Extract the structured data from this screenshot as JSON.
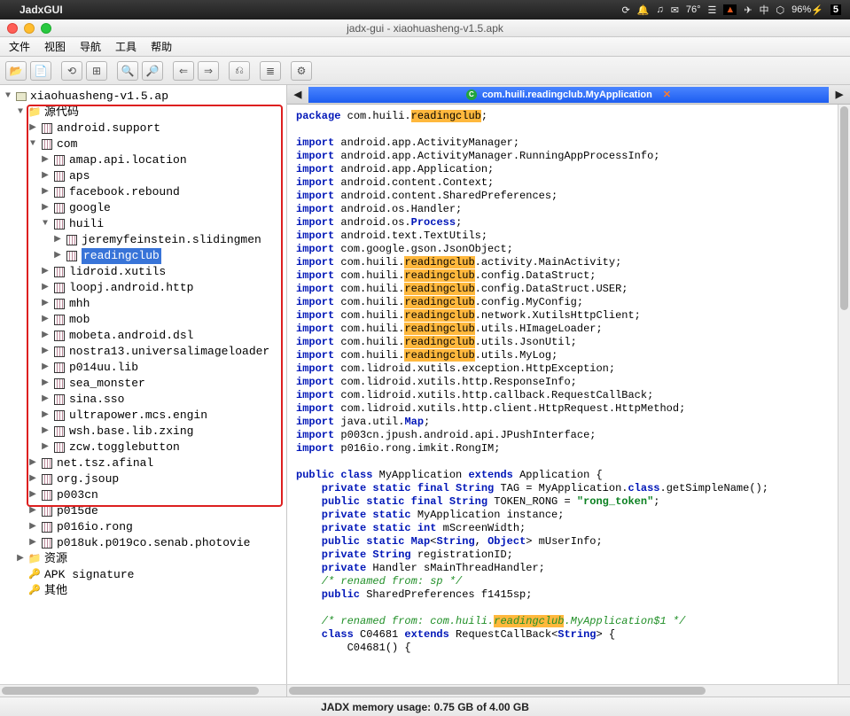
{
  "mac_menu": {
    "app": "JadxGUI",
    "temp": "76°",
    "battery": "96%",
    "ime": "中",
    "other": "5"
  },
  "window_title": "jadx-gui - xiaohuasheng-v1.5.apk",
  "app_menu": [
    "文件",
    "视图",
    "导航",
    "工具",
    "帮助"
  ],
  "tree": {
    "root": "xiaohuasheng-v1.5.ap",
    "binary": "010\n001",
    "sourcecode": "源代码",
    "com_children": [
      "amap.api.location",
      "aps",
      "facebook.rebound",
      "google"
    ],
    "huili": "huili",
    "huili_children": [
      "jeremyfeinstein.slidingmen",
      "readingclub"
    ],
    "com_after": [
      "lidroid.xutils",
      "loopj.android.http",
      "mhh",
      "mob",
      "mobeta.android.dsl",
      "nostra13.universalimageloader",
      "p014uu.lib",
      "sea_monster",
      "sina.sso",
      "ultrapower.mcs.engin",
      "wsh.base.lib.zxing",
      "zcw.togglebutton"
    ],
    "top_after": [
      "net.tsz.afinal",
      "org.jsoup",
      "p003cn",
      "p015de",
      "p016io.rong",
      "p018uk.p019co.senab.photovie"
    ],
    "resources": "资源",
    "apk_sig": "APK signature",
    "other": "其他",
    "android_support": "android.support",
    "com": "com"
  },
  "tab": {
    "label": "com.huili.readingclub.MyApplication"
  },
  "code": {
    "l1a": "package",
    "l1b": " com.huili.",
    "l1c": "readingclub",
    "l1d": ";",
    "imp": "import",
    "i1": " android.app.ActivityManager;",
    "i2": " android.app.ActivityManager.RunningAppProcessInfo;",
    "i3": " android.app.Application;",
    "i4": " android.content.Context;",
    "i5": " android.content.SharedPreferences;",
    "i6": " android.os.Handler;",
    "i7a": " android.os.",
    "i7b": "Process",
    "i7c": ";",
    "i8": " android.text.TextUtils;",
    "i9": " com.google.gson.JsonObject;",
    "h_pre": " com.huili.",
    "h_hl": "readingclub",
    "h1": ".activity.MainActivity;",
    "h2": ".config.DataStruct;",
    "h3": ".config.DataStruct.USER;",
    "h4": ".config.MyConfig;",
    "h5": ".network.XutilsHttpClient;",
    "h6": ".utils.HImageLoader;",
    "h7": ".utils.JsonUtil;",
    "h8": ".utils.MyLog;",
    "i10": " com.lidroid.xutils.exception.HttpException;",
    "i11": " com.lidroid.xutils.http.ResponseInfo;",
    "i12": " com.lidroid.xutils.http.callback.RequestCallBack;",
    "i13": " com.lidroid.xutils.http.client.HttpRequest.HttpMethod;",
    "i14": " java.util.",
    "i14b": "Map",
    "i14c": ";",
    "i15": " p003cn.jpush.android.api.JPushInterface;",
    "i16": " p016io.rong.imkit.RongIM;",
    "cls1": "public class",
    "cls2": " MyApplication ",
    "cls3": "extends",
    "cls4": " Application {",
    "f1a": "    private static final ",
    "f1s": "String",
    "f1b": " TAG = MyApplication.",
    "f1k": "class",
    "f1c": ".getSimpleName();",
    "f2a": "    public static final ",
    "f2b": " TOKEN_RONG = ",
    "f2str": "\"rong_token\"",
    "f2c": ";",
    "f3": "    private static",
    "f3b": " MyApplication instance;",
    "f4a": "    private static ",
    "f4int": "int",
    "f4b": " mScreenWidth;",
    "f5a": "    public static ",
    "f5m": "Map",
    "f5b": "<",
    "f5s": "String",
    "f5c": ", ",
    "f5o": "Object",
    "f5d": "> mUserInfo;",
    "f6a": "    private ",
    "f6b": " registrationID;",
    "f7": "    private",
    "f7b": " Handler sMainThreadHandler;",
    "c1": "    /* renamed from: sp */",
    "f8a": "    public",
    "f8b": " SharedPreferences f1415sp;",
    "c2a": "    /* renamed from: com.huili.",
    "c2b": ".MyApplication$1 */",
    "f9a": "    class",
    "f9b": " C04681 ",
    "f9c": "extends",
    "f9d": " RequestCallBack<",
    "f9e": "> {",
    "f10": "        C04681() {"
  },
  "status": "JADX memory usage: 0.75 GB of 4.00 GB"
}
